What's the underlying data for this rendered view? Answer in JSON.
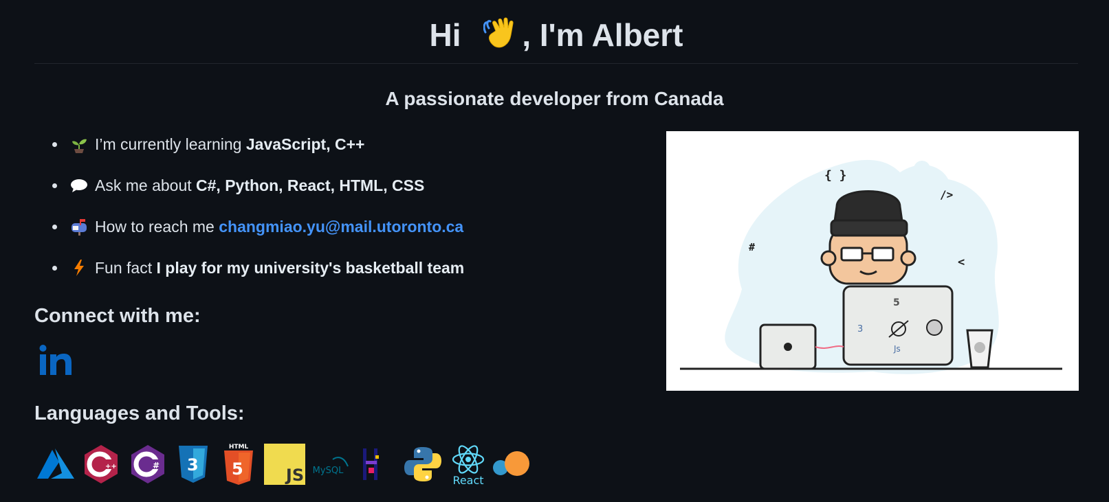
{
  "header": {
    "title_pre": "Hi ",
    "title_post": ", I'm Albert",
    "wave_icon": "waving-hand-icon"
  },
  "subtitle": "A passionate developer from Canada",
  "facts": [
    {
      "icon": "seedling-icon",
      "text": "I’m currently learning ",
      "bold": "JavaScript, C++"
    },
    {
      "icon": "speech-bubble-icon",
      "text": "Ask me about ",
      "bold": "C#, Python, React, HTML, CSS"
    },
    {
      "icon": "mailbox-icon",
      "text": "How to reach me ",
      "link": "changmiao.yu@mail.utoronto.ca"
    },
    {
      "icon": "lightning-icon",
      "text": "Fun fact ",
      "bold": "I play for my university's basketball team"
    }
  ],
  "connect": {
    "heading": "Connect with me:",
    "linkedin_icon": "linkedin-icon"
  },
  "languages": {
    "heading": "Languages and Tools:",
    "tools": [
      "azure",
      "cplusplus",
      "csharp",
      "css3",
      "html5",
      "javascript",
      "mysql",
      "pycharm",
      "python",
      "react",
      "scikit-learn"
    ],
    "labels": {
      "html5": "HTML",
      "mysql": "MySQL",
      "react": "React",
      "javascript": "JS"
    }
  },
  "colors": {
    "background": "#0d1117",
    "link": "#4493f8",
    "text": "#dde3ea"
  }
}
